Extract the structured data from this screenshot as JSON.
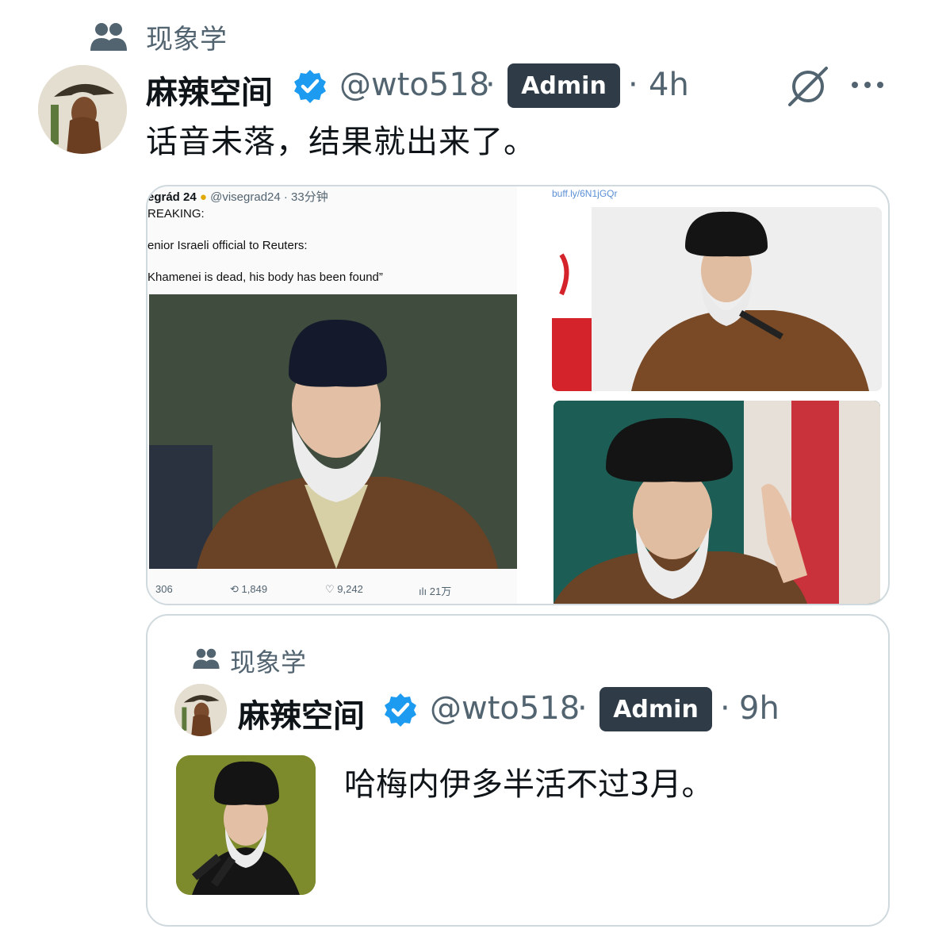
{
  "context": {
    "label": "现象学",
    "icon": "people-icon"
  },
  "post": {
    "author_name": "麻辣空间",
    "verified_icon": "verified-badge-icon",
    "handle": "@wto518",
    "separator": "·",
    "role_badge": "Admin",
    "time": "4h",
    "body": "话音未落，结果就出来了。",
    "actions": {
      "grok_icon": "grok-icon",
      "more_icon": "more-icon"
    }
  },
  "media": {
    "screenshot": {
      "author": "egrád 24",
      "handle_time": "@visegrad24 · 33分钟",
      "line1": "REAKING:",
      "line2": "enior Israeli official to Reuters:",
      "line3": "Khamenei is dead, his body has been found”",
      "stats": {
        "replies": "306",
        "reposts": "1,849",
        "likes": "9,242",
        "views": "21万"
      }
    },
    "link_text": "buff.ly/6N1jGQr"
  },
  "quote": {
    "context_label": "现象学",
    "author_name": "麻辣空间",
    "handle": "@wto518",
    "separator": "·",
    "role_badge": "Admin",
    "time": "9h",
    "body": "哈梅内伊多半活不过3月。"
  },
  "colors": {
    "accent_verified": "#1d9bf0",
    "muted": "#536471",
    "badge_bg": "#2f3b47",
    "border": "#cfd9de"
  }
}
